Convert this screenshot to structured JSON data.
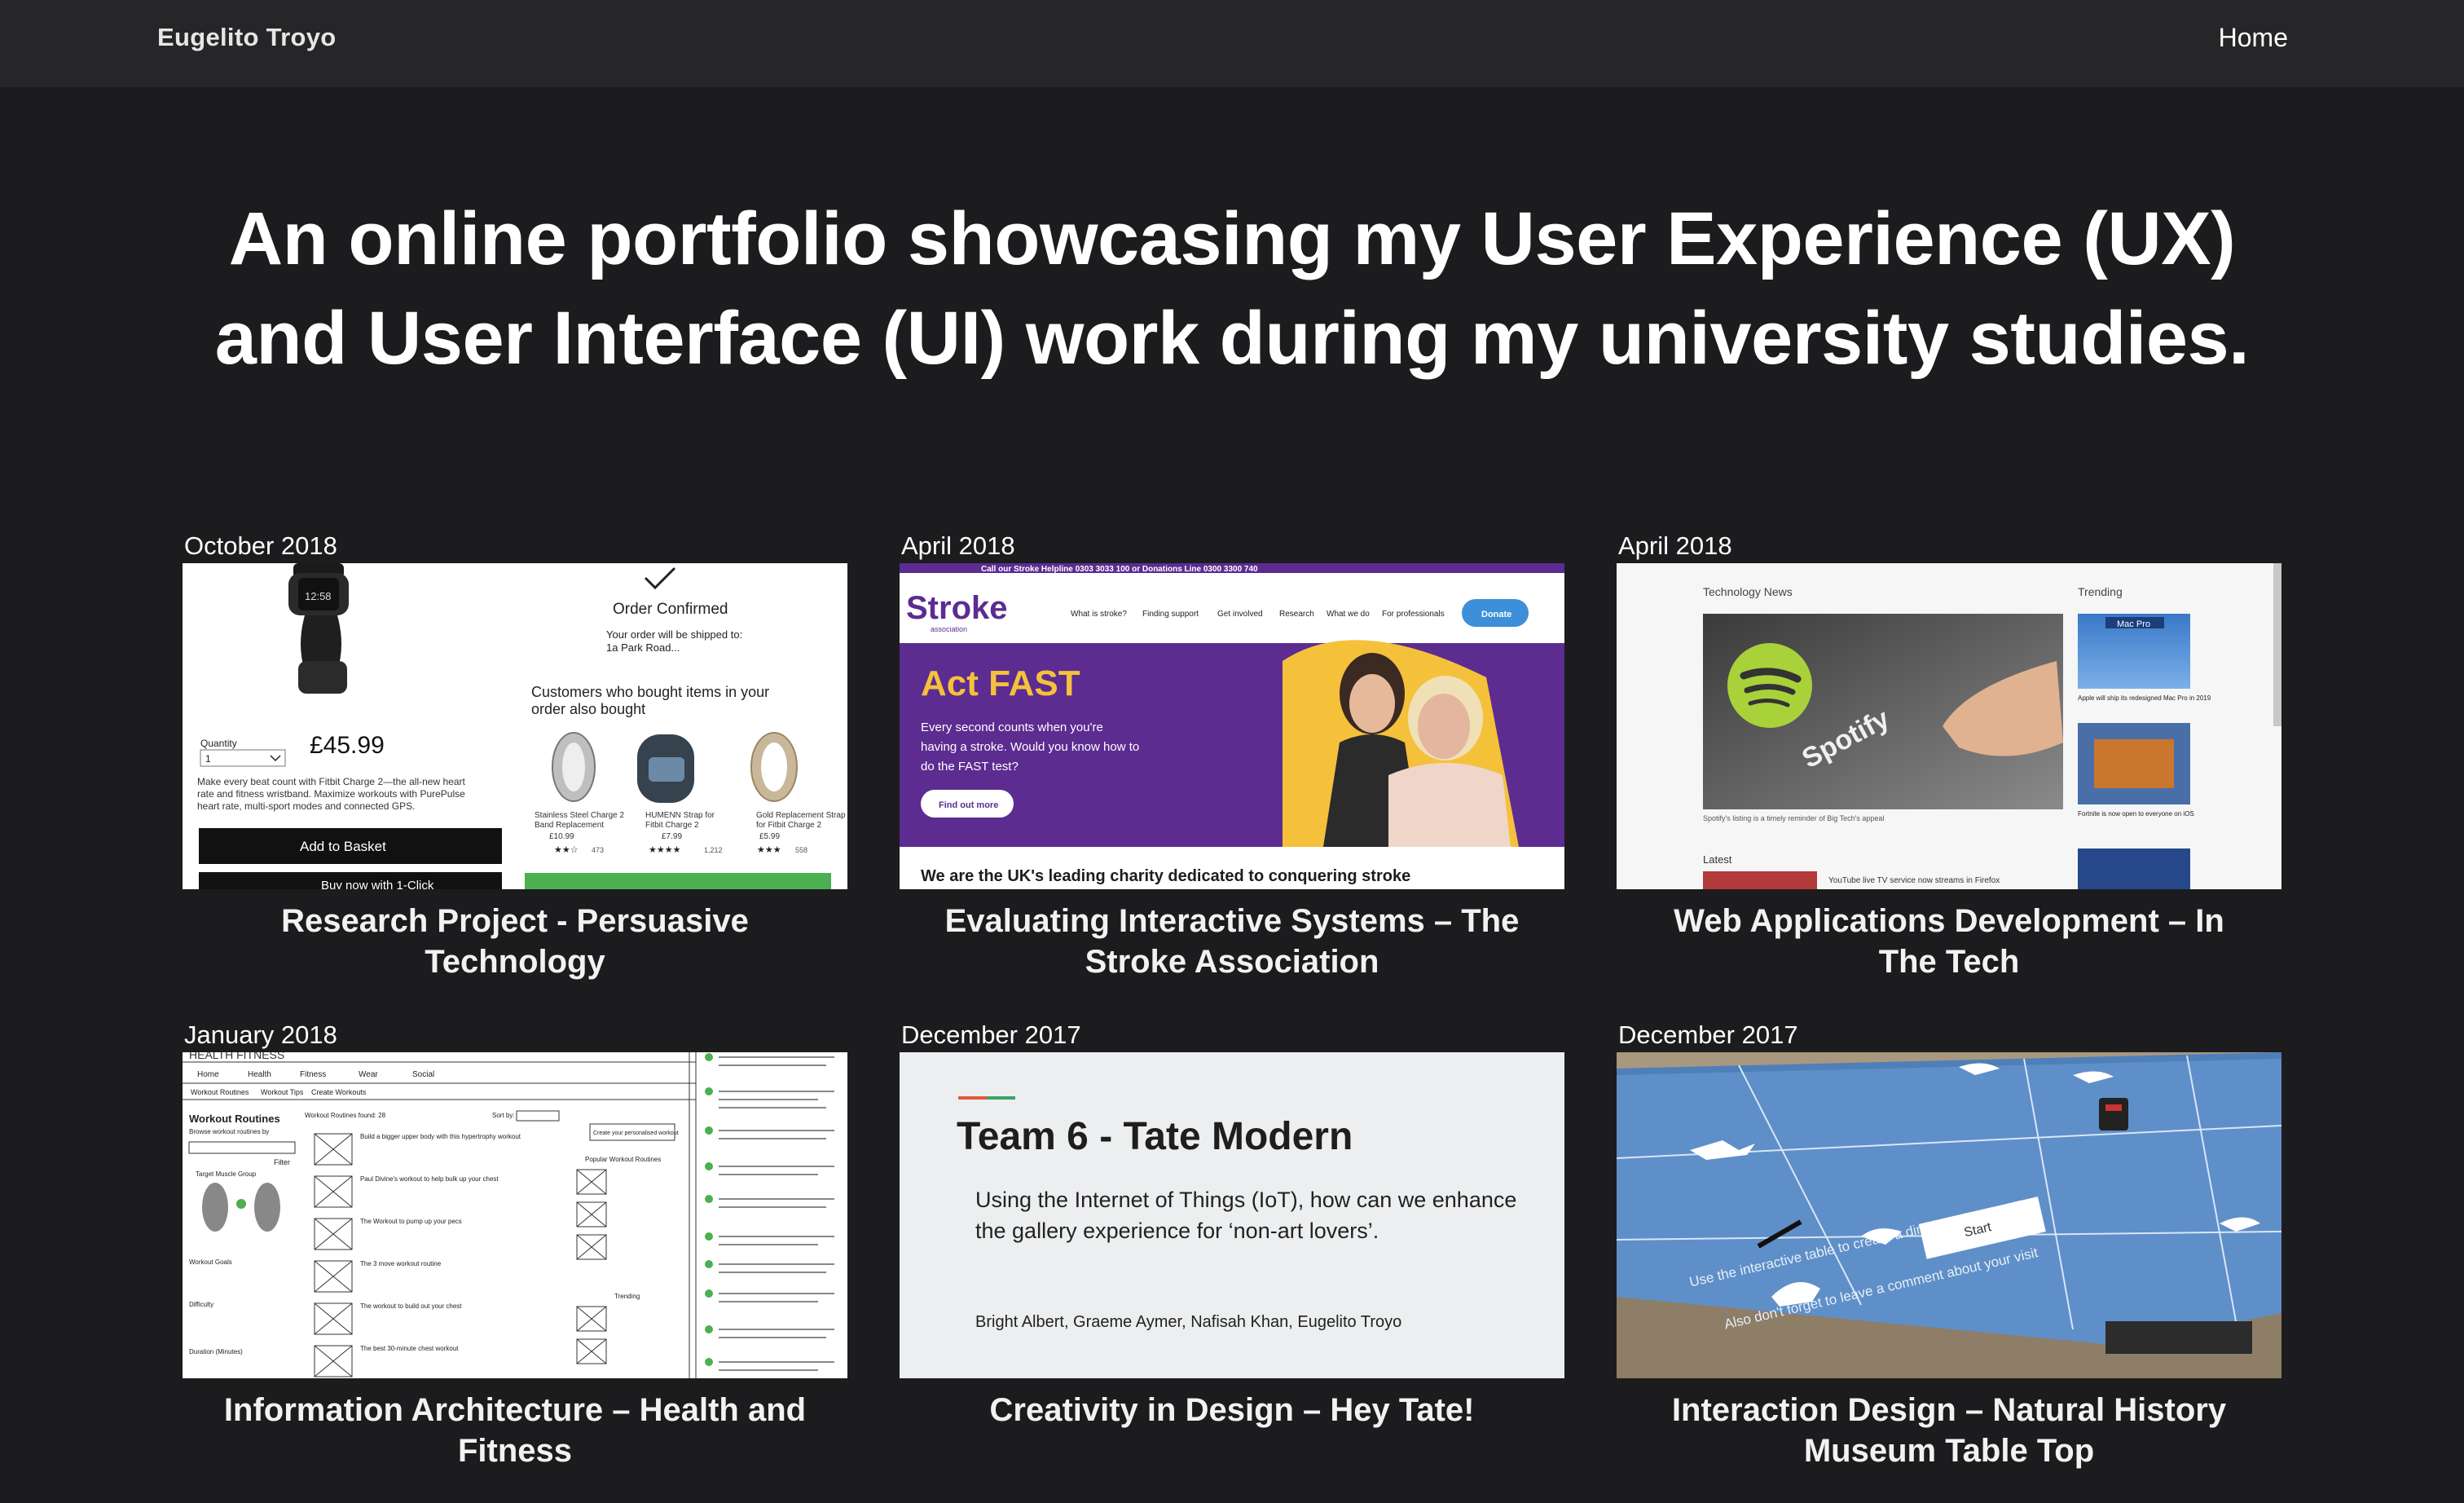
{
  "header": {
    "brand": "Eugelito Troyo",
    "nav_home": "Home"
  },
  "hero": {
    "line1": "An online portfolio showcasing my User Experience (UX)",
    "line2": "and User Interface (UI) work during my university studies."
  },
  "projects": [
    {
      "date": "October 2018",
      "title": "Research Project - Persuasive Technology",
      "thumb": {
        "order_confirmed": "Order Confirmed",
        "ship_to": "Your order will be shipped to:",
        "address": "1a Park Road...",
        "also_bought": "Customers who bought items in your",
        "also_bought2": "order also bought",
        "price": "£45.99",
        "quantity_label": "Quantity",
        "quantity_value": "1",
        "desc1": "Make every beat count with Fitbit Charge 2—the all-new heart",
        "desc2": "rate and fitness wristband. Maximize workouts with PurePulse",
        "desc3": "heart rate, multi-sport modes and connected GPS.",
        "add_to_basket": "Add to Basket",
        "buy_now": "Buy now with 1-Click",
        "watch_time": "12:58",
        "p1_name": "Stainless Steel Charge 2",
        "p1_name2": "Band Replacement",
        "p1_price": "£10.99",
        "p1_reviews": "473",
        "p2_name": "HUMENN Strap for",
        "p2_name2": "Fitbit Charge 2",
        "p2_price": "£7.99",
        "p2_reviews": "1,212",
        "p3_name": "Gold Replacement Strap",
        "p3_name2": "for Fitbit Charge 2",
        "p3_price": "£5.99",
        "p3_reviews": "558"
      }
    },
    {
      "date": "April 2018",
      "title": "Evaluating Interactive Systems – The Stroke Association",
      "thumb": {
        "helpline": "Call our Stroke Helpline 0303 3033 100 or Donations Line 0300 3300 740",
        "logo": "Stroke",
        "logo_sub": "association",
        "nav": [
          "What is stroke?",
          "Finding support",
          "Get involved",
          "Research",
          "What we do",
          "For professionals"
        ],
        "donate": "Donate",
        "actfast": "Act FAST",
        "lead1": "Every second counts when you're",
        "lead2": "having a stroke. Would you know how to",
        "lead3": "do the FAST test?",
        "find_out": "Find out more",
        "footer": "We are the UK's leading charity dedicated to conquering stroke"
      }
    },
    {
      "date": "April 2018",
      "title": "Web Applications Development – In The Tech",
      "thumb": {
        "section": "Technology News",
        "trending": "Trending",
        "spotify_caption": "Spotify's listing is a timely reminder of Big Tech's appeal",
        "trend1_badge": "Mac Pro",
        "trend1": "Apple will ship its redesigned Mac Pro in 2019",
        "trend2": "Fortnite is now open to everyone on iOS",
        "latest": "Latest",
        "latest1": "YouTube live TV service now streams in Firefox"
      }
    },
    {
      "date": "January 2018",
      "title": "Information Architecture – Health and Fitness",
      "thumb": {
        "brand": "HEALTH FITNESS",
        "nav": [
          "Home",
          "Health",
          "Fitness",
          "Wear",
          "Social"
        ],
        "subnav": [
          "Workout Routines",
          "Workout Tips",
          "Create Workouts"
        ],
        "heading": "Workout Routines",
        "subheading": "Browse workout routines by",
        "found": "Workout Routines found: 28",
        "sort": "Sort by:",
        "filter": "Filter",
        "target": "Target Muscle Group",
        "popular": "Popular Workout Routines",
        "trending": "Trending",
        "create": "Create your personalised workout",
        "difficulty": "Difficulty",
        "duration": "Duration (Minutes)",
        "workout_goals": "Workout Goals",
        "routine1": "Build a bigger upper body with this hypertrophy workout",
        "routine2": "Paul Divine's workout to help bulk up your chest",
        "routine3": "The Workout to pump up your pecs",
        "routine4": "The 3 move workout routine",
        "routine5": "The workout to build out your chest",
        "routine6": "The best 30-minute chest workout"
      }
    },
    {
      "date": "December 2017",
      "title": "Creativity in Design – Hey Tate!",
      "thumb": {
        "heading": "Team 6 - Tate Modern",
        "desc": "Using the Internet of Things (IoT), how can we enhance the gallery experience for ‘non-art lovers’.",
        "authors": "Bright Albert, Graeme Aymer, Nafisah Khan, Eugelito Troyo"
      }
    },
    {
      "date": "December 2017",
      "title": "Interaction Design – Natural History Museum Table Top",
      "thumb": {
        "instruction": "Use the interactive table to create a dinosaur that you like",
        "reminder": "Also don't forget to leave a comment about your visit",
        "start": "Start"
      }
    }
  ]
}
